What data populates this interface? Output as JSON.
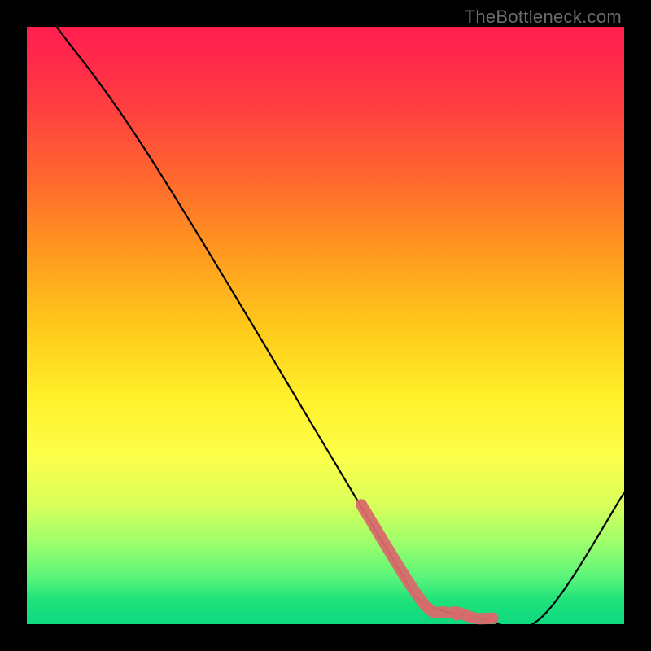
{
  "watermark": "TheBottleneck.com",
  "chart_data": {
    "type": "line",
    "title": "",
    "xlabel": "",
    "ylabel": "",
    "xlim": [
      0,
      100
    ],
    "ylim": [
      0,
      100
    ],
    "series": [
      {
        "name": "bottleneck-curve",
        "x": [
          5,
          22,
          60,
          66,
          76,
          86,
          100
        ],
        "values": [
          100,
          76,
          13,
          4,
          1,
          1,
          22
        ]
      }
    ],
    "highlight_segment": {
      "name": "thick-red-band",
      "x": [
        56,
        66,
        70,
        72,
        75,
        78
      ],
      "values": [
        20,
        4,
        2,
        2,
        1,
        1
      ]
    },
    "highlight_dots": {
      "name": "red-dots",
      "points": [
        {
          "x": 67,
          "y": 3
        },
        {
          "x": 72,
          "y": 1.5
        },
        {
          "x": 74,
          "y": 1.2
        },
        {
          "x": 78,
          "y": 1
        }
      ]
    }
  }
}
